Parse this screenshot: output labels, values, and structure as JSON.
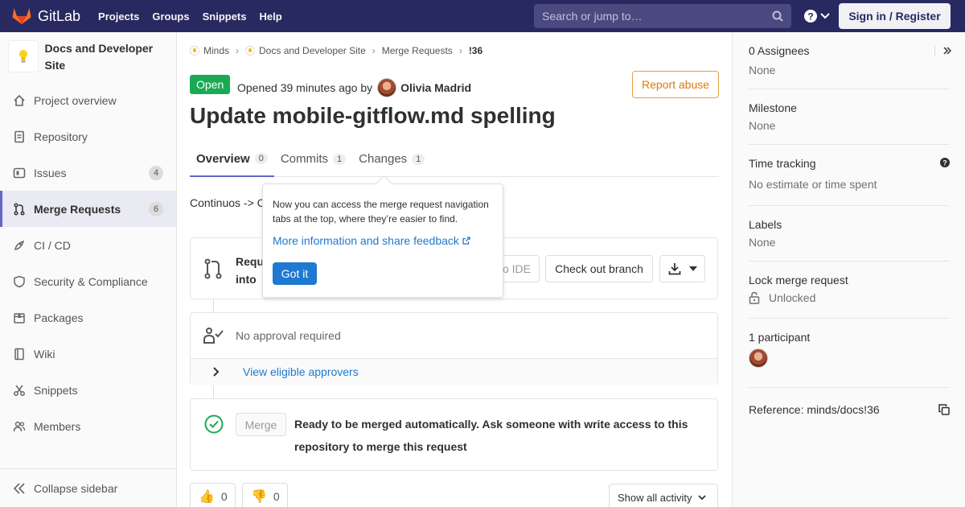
{
  "topbar": {
    "brand": "GitLab",
    "nav": [
      "Projects",
      "Groups",
      "Snippets",
      "Help"
    ],
    "search_placeholder": "Search or jump to…",
    "signin": "Sign in / Register"
  },
  "sidebar": {
    "project_name": "Docs and Developer Site",
    "items": [
      {
        "label": "Project overview",
        "icon": "home-icon"
      },
      {
        "label": "Repository",
        "icon": "doc-icon"
      },
      {
        "label": "Issues",
        "icon": "issues-icon",
        "badge": "4"
      },
      {
        "label": "Merge Requests",
        "icon": "merge-request-icon",
        "badge": "6",
        "active": true
      },
      {
        "label": "CI / CD",
        "icon": "rocket-icon"
      },
      {
        "label": "Security & Compliance",
        "icon": "shield-icon"
      },
      {
        "label": "Packages",
        "icon": "package-icon"
      },
      {
        "label": "Wiki",
        "icon": "book-icon"
      },
      {
        "label": "Snippets",
        "icon": "scissors-icon"
      },
      {
        "label": "Members",
        "icon": "users-icon"
      }
    ],
    "collapse": "Collapse sidebar"
  },
  "breadcrumb": [
    "Minds",
    "Docs and Developer Site",
    "Merge Requests",
    "!36"
  ],
  "mr": {
    "status": "Open",
    "opened_text": "Opened 39 minutes ago by",
    "author": "Olivia Madrid",
    "report": "Report abuse",
    "title": "Update mobile-gitflow.md spelling",
    "tabs": [
      {
        "label": "Overview",
        "count": "0"
      },
      {
        "label": "Commits",
        "count": "1"
      },
      {
        "label": "Changes",
        "count": "1"
      }
    ],
    "description": "Continuos -> C",
    "merge_info_line1": "Requ",
    "merge_info_line2": "into",
    "open_ide_fragment": "o IDE",
    "checkout_branch": "Check out branch",
    "approval_text": "No approval required",
    "view_approvers": "View eligible approvers",
    "merge_button": "Merge",
    "ready_text": "Ready to be merged automatically. Ask someone with write access to this repository to merge this request",
    "thumbs_up": "0",
    "thumbs_down": "0",
    "activity_filter": "Show all activity"
  },
  "popover": {
    "text": "Now you can access the merge request navigation tabs at the top, where they’re easier to find.",
    "link": "More information and share feedback",
    "button": "Got it"
  },
  "right_sidebar": {
    "assignees_title": "0 Assignees",
    "assignees_value": "None",
    "milestone_title": "Milestone",
    "milestone_value": "None",
    "time_title": "Time tracking",
    "time_value": "No estimate or time spent",
    "labels_title": "Labels",
    "labels_value": "None",
    "lock_title": "Lock merge request",
    "lock_value": "Unlocked",
    "participants_title": "1 participant",
    "reference": "Reference: minds/docs!36"
  },
  "colors": {
    "nav_bg": "#292961",
    "open_badge": "#1aaa55",
    "link": "#1f78d1",
    "report_border": "#e7a03d"
  }
}
